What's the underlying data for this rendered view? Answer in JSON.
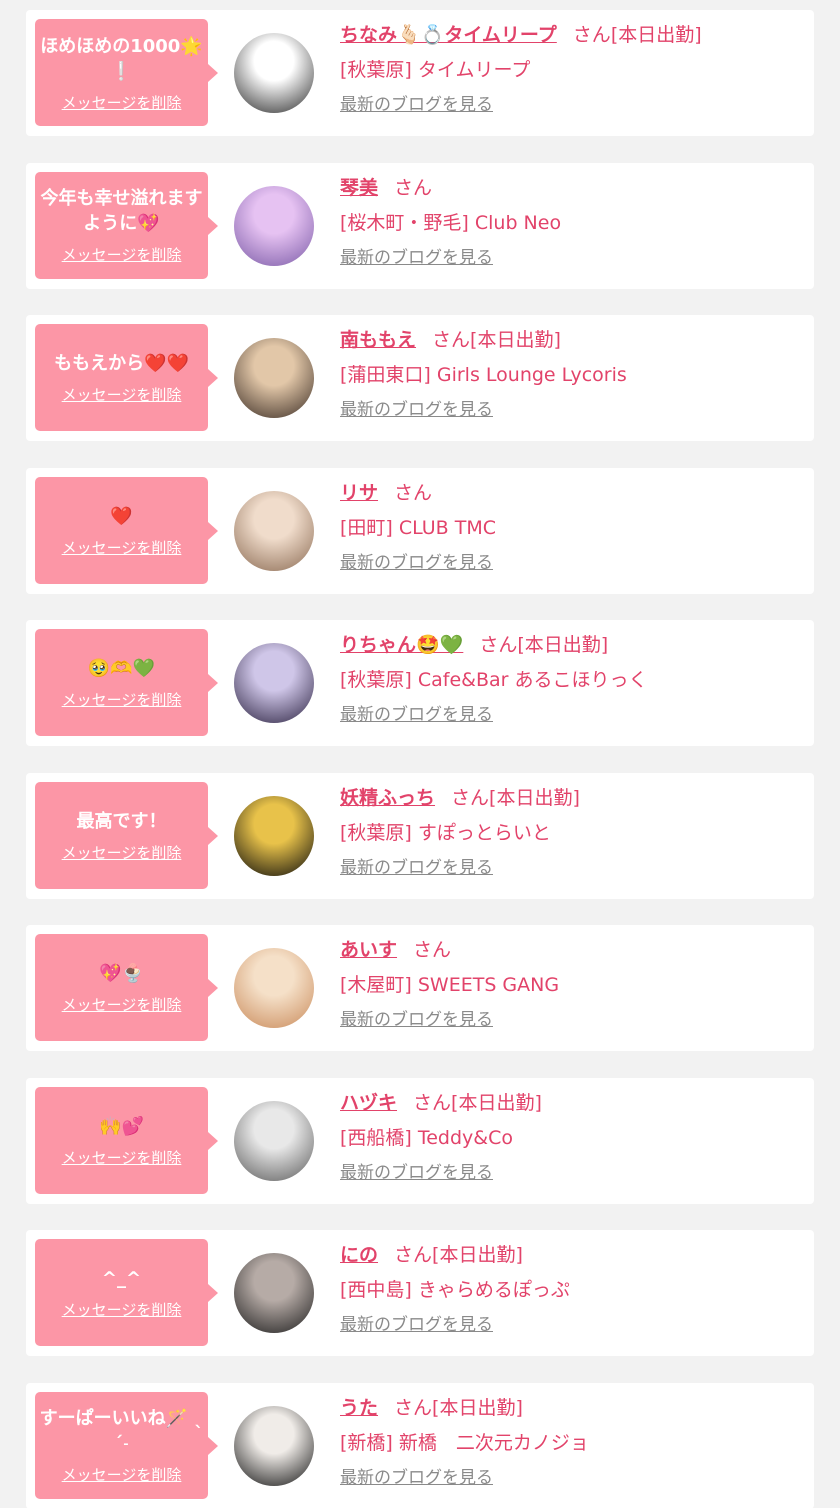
{
  "delete_label": "メッセージを削除",
  "blog_label": "最新のブログを見る",
  "honorific": "さん",
  "attendance": "[本日出勤]",
  "colors": {
    "page_bg": "#f2f2f2",
    "bubble": "#fc96a6",
    "accent": "#e2436a",
    "link_gray": "#8a8a8a"
  },
  "entries": [
    {
      "message": "ほめほめの1000🌟❕",
      "name": "ちなみ🫰🏻💍タイムリープ",
      "working_today": true,
      "shop": "[秋葉原] タイムリープ",
      "avatar_colors": [
        "#ffffff",
        "#2a2a2a"
      ]
    },
    {
      "message": "今年も幸せ溢れますように💖",
      "name": "琴美",
      "working_today": false,
      "shop": "[桜木町・野毛] Club Neo",
      "avatar_colors": [
        "#e6c2f2",
        "#7a5aa6"
      ]
    },
    {
      "message": "ももえから❤️❤️",
      "name": "南ももえ",
      "working_today": true,
      "shop": "[蒲田東口] Girls Lounge Lycoris",
      "avatar_colors": [
        "#e2c7a8",
        "#3a2c24"
      ]
    },
    {
      "message": "❤️",
      "name": "リサ",
      "working_today": false,
      "shop": "[田町] CLUB TMC",
      "avatar_colors": [
        "#f0dccb",
        "#8a6a52"
      ]
    },
    {
      "message": "🥹🫶💚",
      "name": "りちゃん🤩💚",
      "working_today": true,
      "shop": "[秋葉原] Cafe&Bar あるこほりっく",
      "avatar_colors": [
        "#cfc6e8",
        "#2b2240"
      ]
    },
    {
      "message": "最高です！",
      "name": "妖精ふっち",
      "working_today": true,
      "shop": "[秋葉原] すぽっとらいと",
      "avatar_colors": [
        "#e8c24a",
        "#0a0a0a"
      ]
    },
    {
      "message": "💖🍨",
      "name": "あいす",
      "working_today": false,
      "shop": "[木屋町] SWEETS GANG",
      "avatar_colors": [
        "#f5e0c8",
        "#c98a5a"
      ]
    },
    {
      "message": "🙌💕",
      "name": "ハヅキ",
      "working_today": true,
      "shop": "[西船橋] Teddy&Co",
      "avatar_colors": [
        "#e8e8e8",
        "#5a5a5a"
      ]
    },
    {
      "message": "^_^",
      "name": "にの",
      "working_today": true,
      "shop": "[西中島] きゃらめるぽっぷ",
      "avatar_colors": [
        "#b6aba6",
        "#1c1c1c"
      ]
    },
    {
      "message": "すーぱーいいね🪄 ˎˊ˗",
      "name": "うた",
      "working_today": true,
      "shop": "[新橋] 新橋　二次元カノジョ",
      "avatar_colors": [
        "#f0ece8",
        "#111111"
      ]
    }
  ]
}
